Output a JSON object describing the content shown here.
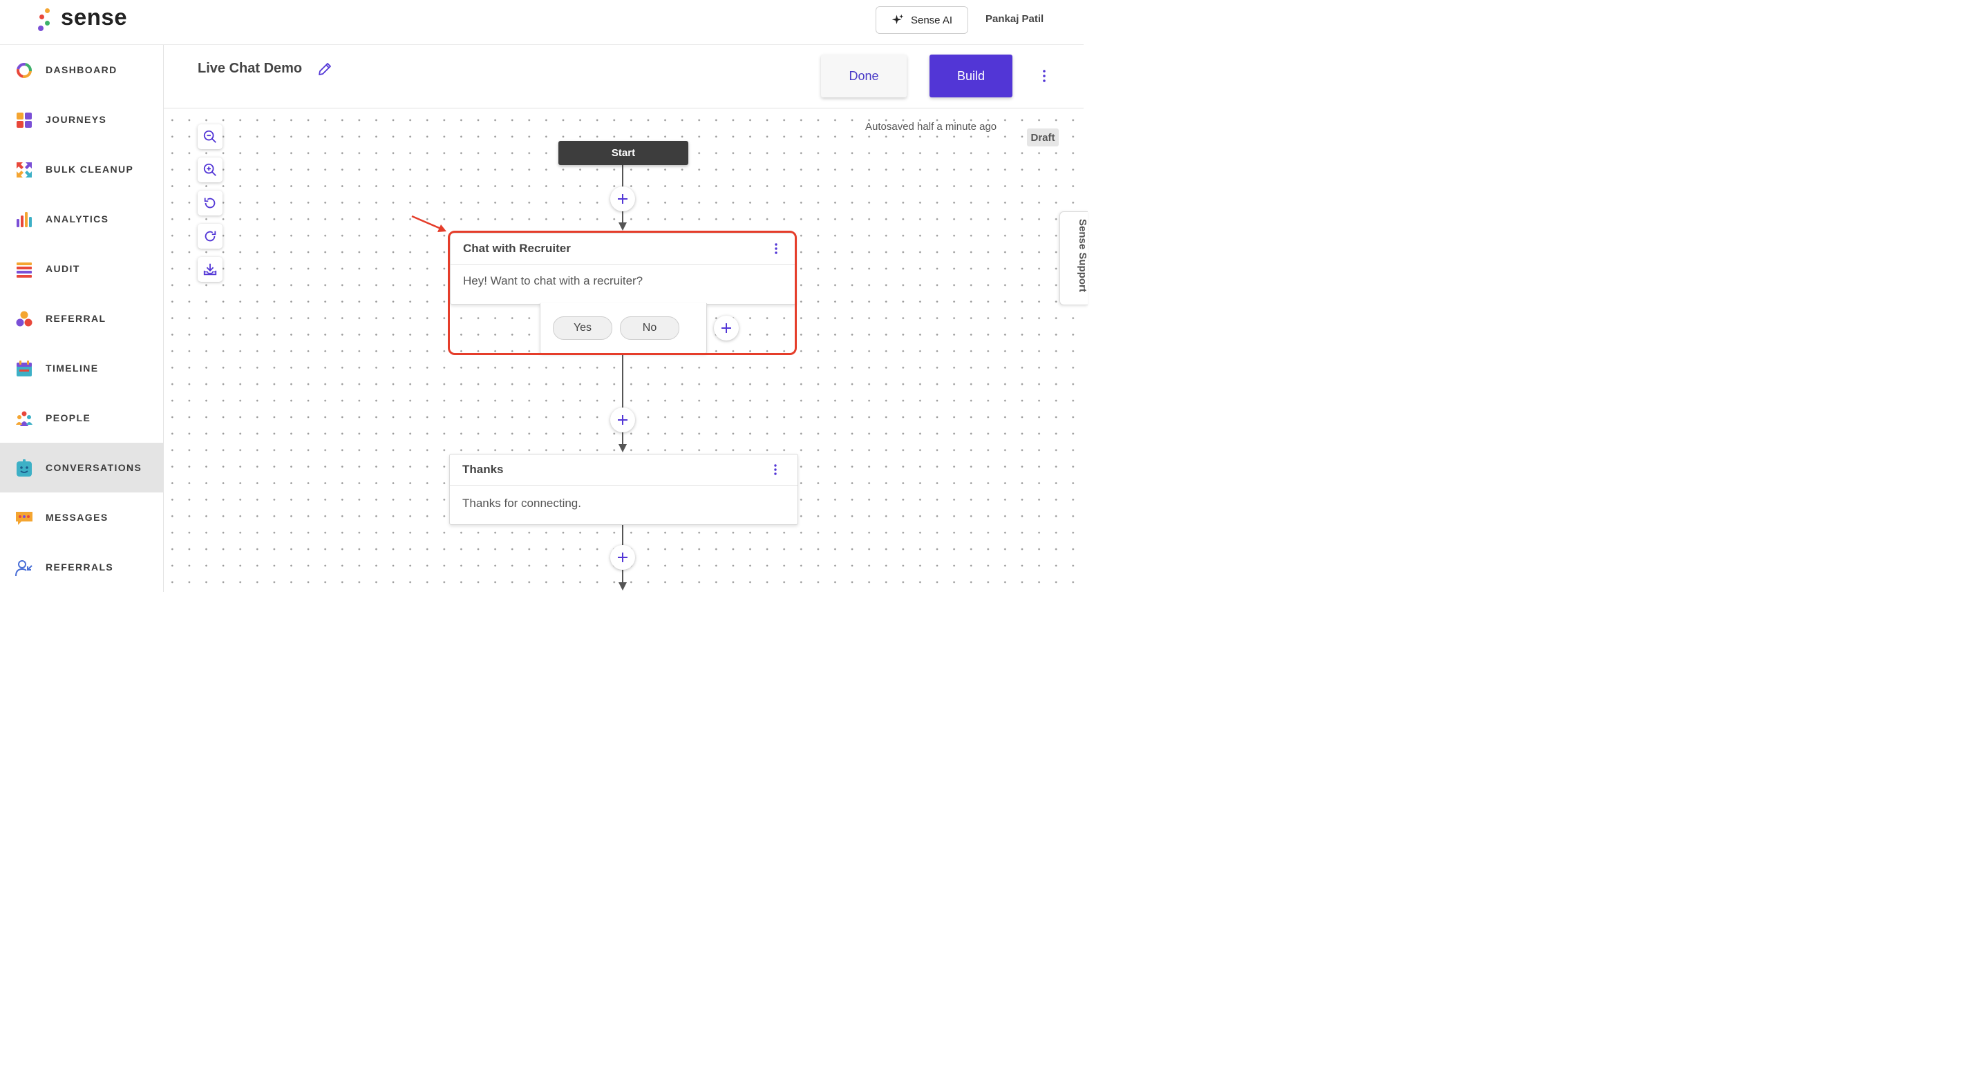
{
  "app": {
    "brand": "sense",
    "user": "Pankaj Patil",
    "sense_ai_label": "Sense AI"
  },
  "sidebar": {
    "items": [
      {
        "label": "DASHBOARD",
        "icon": "dashboard-icon"
      },
      {
        "label": "JOURNEYS",
        "icon": "journeys-icon"
      },
      {
        "label": "BULK CLEANUP",
        "icon": "bulk-cleanup-icon"
      },
      {
        "label": "ANALYTICS",
        "icon": "analytics-icon"
      },
      {
        "label": "AUDIT",
        "icon": "audit-icon"
      },
      {
        "label": "REFERRAL",
        "icon": "referral-icon"
      },
      {
        "label": "TIMELINE",
        "icon": "timeline-icon"
      },
      {
        "label": "PEOPLE",
        "icon": "people-icon"
      },
      {
        "label": "CONVERSATIONS",
        "icon": "conversations-icon",
        "active": true
      },
      {
        "label": "MESSAGES",
        "icon": "messages-icon"
      },
      {
        "label": "REFERRALS",
        "icon": "referrals-icon"
      }
    ]
  },
  "header": {
    "title": "Live Chat Demo",
    "done_label": "Done",
    "build_label": "Build"
  },
  "canvas": {
    "autosave_text": "Autosaved half a minute ago",
    "status_badge": "Draft",
    "support_tab": "Sense Support",
    "start_label": "Start",
    "nodes": [
      {
        "title": "Chat with Recruiter",
        "message": "Hey! Want to chat with a recruiter?",
        "choices": [
          "Yes",
          "No"
        ],
        "highlighted": true
      },
      {
        "title": "Thanks",
        "message": "Thanks for connecting."
      }
    ]
  },
  "colors": {
    "accent": "#5236d6",
    "highlight": "#e53d2a",
    "active_nav": "#e4e4e4"
  }
}
